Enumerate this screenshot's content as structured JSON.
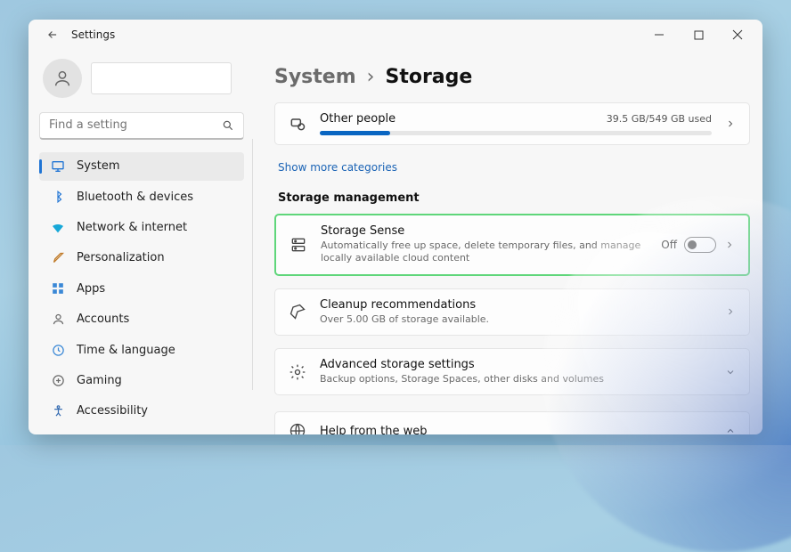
{
  "window": {
    "app_title": "Settings"
  },
  "sidebar": {
    "search_placeholder": "Find a setting",
    "items": [
      {
        "label": "System"
      },
      {
        "label": "Bluetooth & devices"
      },
      {
        "label": "Network & internet"
      },
      {
        "label": "Personalization"
      },
      {
        "label": "Apps"
      },
      {
        "label": "Accounts"
      },
      {
        "label": "Time & language"
      },
      {
        "label": "Gaming"
      },
      {
        "label": "Accessibility"
      }
    ]
  },
  "breadcrumb": {
    "parent": "System",
    "sep": "›",
    "current": "Storage"
  },
  "storage": {
    "category": {
      "title": "Other people",
      "usage": "39.5 GB/549 GB used"
    },
    "show_more": "Show more categories",
    "section_label": "Storage management",
    "sense": {
      "title": "Storage Sense",
      "desc": "Automatically free up space, delete temporary files, and manage locally available cloud content",
      "toggle_label": "Off"
    },
    "cleanup": {
      "title": "Cleanup recommendations",
      "desc": "Over 5.00 GB of storage available."
    },
    "advanced": {
      "title": "Advanced storage settings",
      "desc": "Backup options, Storage Spaces, other disks and volumes"
    },
    "help": {
      "title": "Help from the web"
    }
  }
}
